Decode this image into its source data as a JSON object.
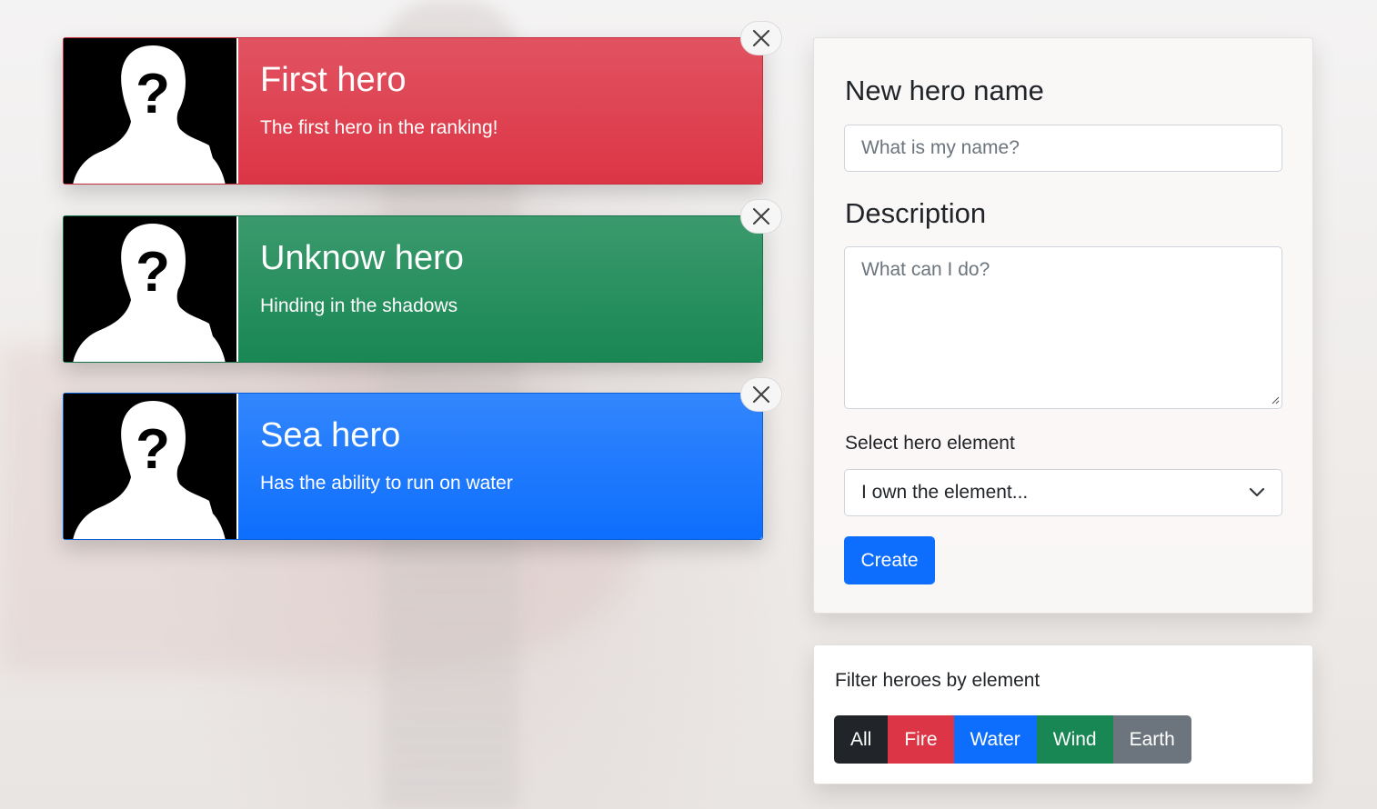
{
  "heroes": [
    {
      "name": "First hero",
      "description": "The first hero in the ranking!",
      "color": "#dc3545"
    },
    {
      "name": "Unknow hero",
      "description": "Hinding in the shadows",
      "color": "#198754"
    },
    {
      "name": "Sea hero",
      "description": "Has the ability to run on water",
      "color": "#0d6efd"
    }
  ],
  "form": {
    "name_title": "New hero name",
    "name_placeholder": "What is my name?",
    "description_title": "Description",
    "description_placeholder": "What can I do?",
    "select_label": "Select hero element",
    "select_value": "I own the element...",
    "create_label": "Create"
  },
  "filter": {
    "label": "Filter heroes by element",
    "buttons": [
      {
        "label": "All",
        "color": "#212529"
      },
      {
        "label": "Fire",
        "color": "#dc3545"
      },
      {
        "label": "Water",
        "color": "#0d6efd"
      },
      {
        "label": "Wind",
        "color": "#198754"
      },
      {
        "label": "Earth",
        "color": "#6c757d"
      }
    ]
  },
  "icons": {
    "close": "close-icon",
    "avatar": "unknown-person-icon",
    "chevron": "chevron-down-icon"
  }
}
